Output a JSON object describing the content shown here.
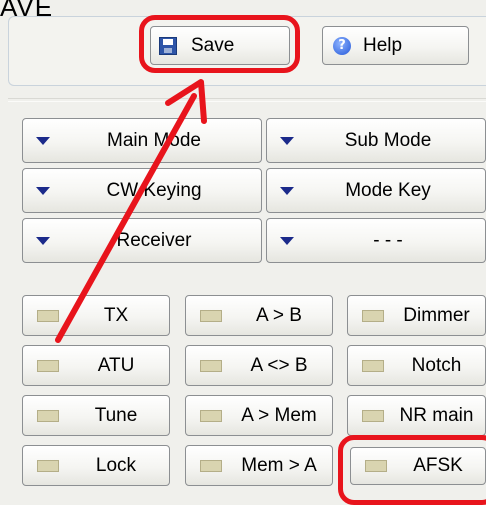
{
  "title_fragment": "AVE",
  "top": {
    "save_label": "Save",
    "help_label": "Help"
  },
  "dropdowns": [
    {
      "name": "main-mode-dropdown",
      "label": "Main Mode"
    },
    {
      "name": "sub-mode-dropdown",
      "label": "Sub Mode"
    },
    {
      "name": "cw-keying-dropdown",
      "label": "CW Keying"
    },
    {
      "name": "mode-key-dropdown",
      "label": "Mode Key"
    },
    {
      "name": "receiver-dropdown",
      "label": "Receiver"
    },
    {
      "name": "unnamed-dropdown",
      "label": "- - -"
    }
  ],
  "toggles": [
    {
      "name": "tx-toggle",
      "label": "TX"
    },
    {
      "name": "a-to-b-toggle",
      "label": "A > B"
    },
    {
      "name": "dimmer-toggle",
      "label": "Dimmer"
    },
    {
      "name": "atu-toggle",
      "label": "ATU"
    },
    {
      "name": "a-swap-b-toggle",
      "label": "A <> B"
    },
    {
      "name": "notch-toggle",
      "label": "Notch"
    },
    {
      "name": "tune-toggle",
      "label": "Tune"
    },
    {
      "name": "a-to-mem-toggle",
      "label": "A > Mem"
    },
    {
      "name": "nr-main-toggle",
      "label": "NR main"
    },
    {
      "name": "lock-toggle",
      "label": "Lock"
    },
    {
      "name": "mem-to-a-toggle",
      "label": "Mem > A"
    },
    {
      "name": "afsk-toggle",
      "label": "AFSK"
    }
  ],
  "colors": {
    "annotation": "#e8141c",
    "dropdown_arrow": "#1b2a8a",
    "indicator": "#d9d4b0"
  },
  "icons": {
    "save": "floppy-disk-icon",
    "help": "question-circle-icon",
    "dropdown": "triangle-down-icon",
    "toggle": "led-indicator-icon"
  }
}
